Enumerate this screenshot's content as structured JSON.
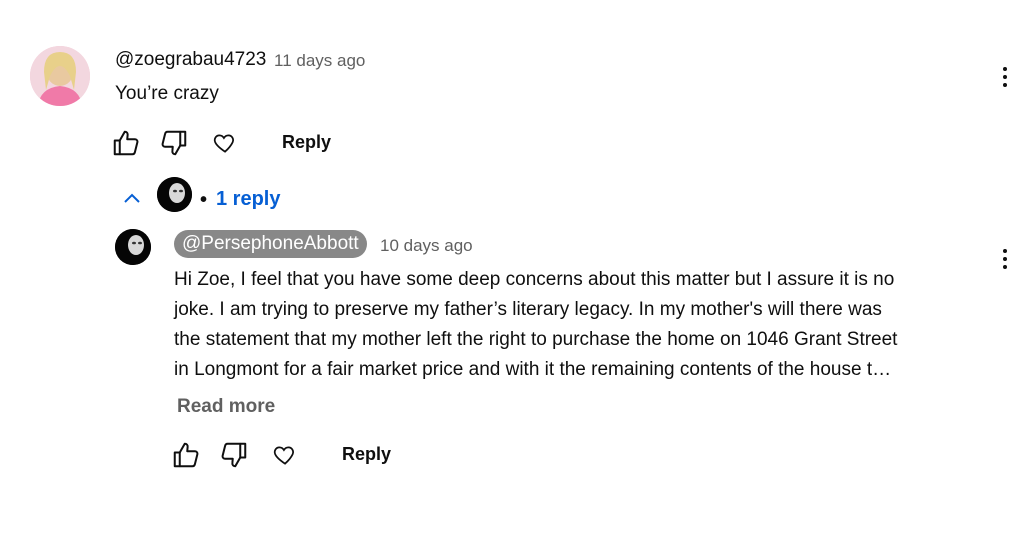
{
  "comment": {
    "author": "@zoegrabau4723",
    "time": "11 days ago",
    "text": "You’re crazy",
    "reply_label": "Reply"
  },
  "replies_toggle": {
    "count_label": "1 reply",
    "separator": "•"
  },
  "reply": {
    "author": "@PersephoneAbbott",
    "time": "10 days ago",
    "lines": [
      "Hi Zoe, I feel that you have some deep concerns about this matter but I assure it is no",
      "joke. I am trying to preserve my father’s literary legacy. In my mother's will there was",
      "the statement that my mother left the right to purchase the home on 1046 Grant Street",
      "in Longmont for a fair market price and with it the remaining contents of the house t…"
    ],
    "read_more": "Read more",
    "reply_label": "Reply"
  },
  "icons": {
    "like": "thumbs-up-icon",
    "dislike": "thumbs-down-icon",
    "heart": "heart-icon",
    "menu": "more-vert-icon",
    "collapse": "chevron-up-icon"
  }
}
